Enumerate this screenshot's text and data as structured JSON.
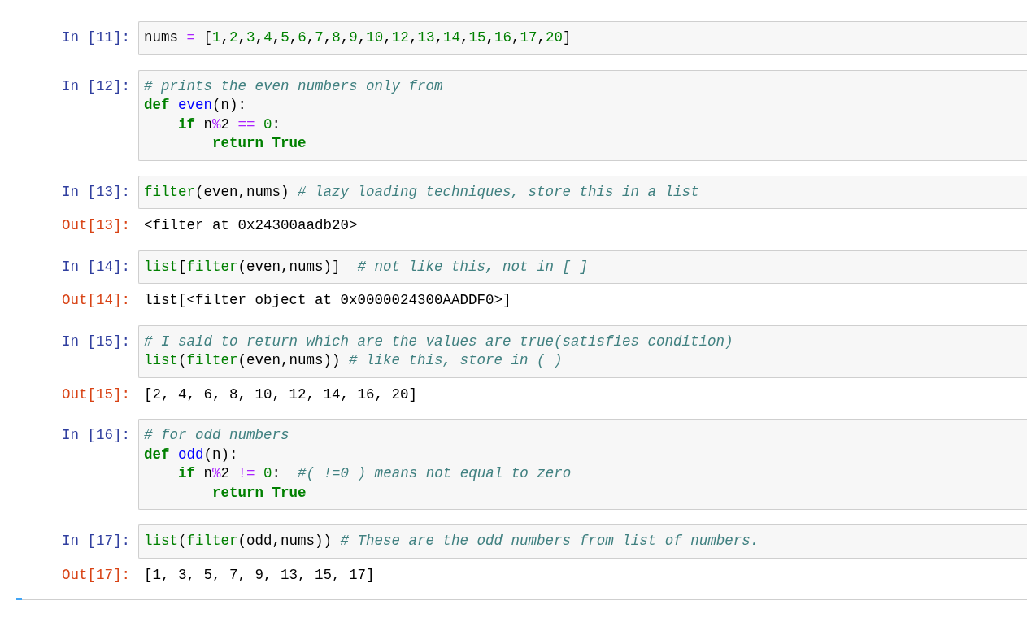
{
  "cells": [
    {
      "prompt": "In [11]:",
      "lines": [
        [
          {
            "t": "nums ",
            "kind": "name"
          },
          {
            "t": "=",
            "kind": "operator"
          },
          {
            "t": " [",
            "kind": "plain"
          },
          {
            "t": "1",
            "kind": "number"
          },
          {
            "t": ",",
            "kind": "plain"
          },
          {
            "t": "2",
            "kind": "number"
          },
          {
            "t": ",",
            "kind": "plain"
          },
          {
            "t": "3",
            "kind": "number"
          },
          {
            "t": ",",
            "kind": "plain"
          },
          {
            "t": "4",
            "kind": "number"
          },
          {
            "t": ",",
            "kind": "plain"
          },
          {
            "t": "5",
            "kind": "number"
          },
          {
            "t": ",",
            "kind": "plain"
          },
          {
            "t": "6",
            "kind": "number"
          },
          {
            "t": ",",
            "kind": "plain"
          },
          {
            "t": "7",
            "kind": "number"
          },
          {
            "t": ",",
            "kind": "plain"
          },
          {
            "t": "8",
            "kind": "number"
          },
          {
            "t": ",",
            "kind": "plain"
          },
          {
            "t": "9",
            "kind": "number"
          },
          {
            "t": ",",
            "kind": "plain"
          },
          {
            "t": "10",
            "kind": "number"
          },
          {
            "t": ",",
            "kind": "plain"
          },
          {
            "t": "12",
            "kind": "number"
          },
          {
            "t": ",",
            "kind": "plain"
          },
          {
            "t": "13",
            "kind": "number"
          },
          {
            "t": ",",
            "kind": "plain"
          },
          {
            "t": "14",
            "kind": "number"
          },
          {
            "t": ",",
            "kind": "plain"
          },
          {
            "t": "15",
            "kind": "number"
          },
          {
            "t": ",",
            "kind": "plain"
          },
          {
            "t": "16",
            "kind": "number"
          },
          {
            "t": ",",
            "kind": "plain"
          },
          {
            "t": "17",
            "kind": "number"
          },
          {
            "t": ",",
            "kind": "plain"
          },
          {
            "t": "20",
            "kind": "number"
          },
          {
            "t": "]",
            "kind": "plain"
          }
        ]
      ]
    },
    {
      "prompt": "In [12]:",
      "lines": [
        [
          {
            "t": "# prints the even numbers only from",
            "kind": "comment"
          }
        ],
        [
          {
            "t": "def",
            "kind": "keyword"
          },
          {
            "t": " even",
            "kind": "function"
          },
          {
            "t": "(n):",
            "kind": "plain"
          }
        ],
        [
          {
            "t": "    if",
            "kind": "keyword"
          },
          {
            "t": " n",
            "kind": "plain"
          },
          {
            "t": "%",
            "kind": "operator"
          },
          {
            "t": "2 ",
            "kind": "plain"
          },
          {
            "t": "==",
            "kind": "operator"
          },
          {
            "t": " 0",
            "kind": "number"
          },
          {
            "t": ":",
            "kind": "plain"
          }
        ],
        [
          {
            "t": "        return True",
            "kind": "keyword"
          }
        ]
      ]
    },
    {
      "prompt": "In [13]:",
      "lines": [
        [
          {
            "t": "filter",
            "kind": "builtin"
          },
          {
            "t": "(even,nums) ",
            "kind": "plain"
          },
          {
            "t": "# lazy loading techniques, store this in a list",
            "kind": "comment"
          }
        ]
      ],
      "output": {
        "prompt": "Out[13]:",
        "text": "<filter at 0x24300aadb20>"
      }
    },
    {
      "prompt": "In [14]:",
      "lines": [
        [
          {
            "t": "list",
            "kind": "builtin"
          },
          {
            "t": "[",
            "kind": "plain"
          },
          {
            "t": "filter",
            "kind": "builtin"
          },
          {
            "t": "(even,nums)]  ",
            "kind": "plain"
          },
          {
            "t": "# not like this, not in [ ]",
            "kind": "comment"
          }
        ]
      ],
      "output": {
        "prompt": "Out[14]:",
        "text": "list[<filter object at 0x0000024300AADDF0>]"
      }
    },
    {
      "prompt": "In [15]:",
      "lines": [
        [
          {
            "t": "# I said to return which are the values are true(satisfies condition)",
            "kind": "comment"
          }
        ],
        [
          {
            "t": "list",
            "kind": "builtin"
          },
          {
            "t": "(",
            "kind": "plain"
          },
          {
            "t": "filter",
            "kind": "builtin"
          },
          {
            "t": "(even,nums)) ",
            "kind": "plain"
          },
          {
            "t": "# like this, store in ( )",
            "kind": "comment"
          }
        ]
      ],
      "output": {
        "prompt": "Out[15]:",
        "text": "[2, 4, 6, 8, 10, 12, 14, 16, 20]"
      }
    },
    {
      "prompt": "In [16]:",
      "lines": [
        [
          {
            "t": "# for odd numbers",
            "kind": "comment"
          }
        ],
        [
          {
            "t": "def",
            "kind": "keyword"
          },
          {
            "t": " odd",
            "kind": "function"
          },
          {
            "t": "(n):",
            "kind": "plain"
          }
        ],
        [
          {
            "t": "    if",
            "kind": "keyword"
          },
          {
            "t": " n",
            "kind": "plain"
          },
          {
            "t": "%",
            "kind": "operator"
          },
          {
            "t": "2 ",
            "kind": "plain"
          },
          {
            "t": "!=",
            "kind": "operator"
          },
          {
            "t": " 0",
            "kind": "number"
          },
          {
            "t": ":  ",
            "kind": "plain"
          },
          {
            "t": "#( !=0 ) means not equal to zero",
            "kind": "comment"
          }
        ],
        [
          {
            "t": "        return True",
            "kind": "keyword"
          }
        ]
      ]
    },
    {
      "prompt": "In [17]:",
      "lines": [
        [
          {
            "t": "list",
            "kind": "builtin"
          },
          {
            "t": "(",
            "kind": "plain"
          },
          {
            "t": "filter",
            "kind": "builtin"
          },
          {
            "t": "(odd,nums)) ",
            "kind": "plain"
          },
          {
            "t": "# These are the odd numbers from list of numbers.",
            "kind": "comment"
          }
        ]
      ],
      "output": {
        "prompt": "Out[17]:",
        "text": "[1, 3, 5, 7, 9, 13, 15, 17]"
      }
    }
  ]
}
